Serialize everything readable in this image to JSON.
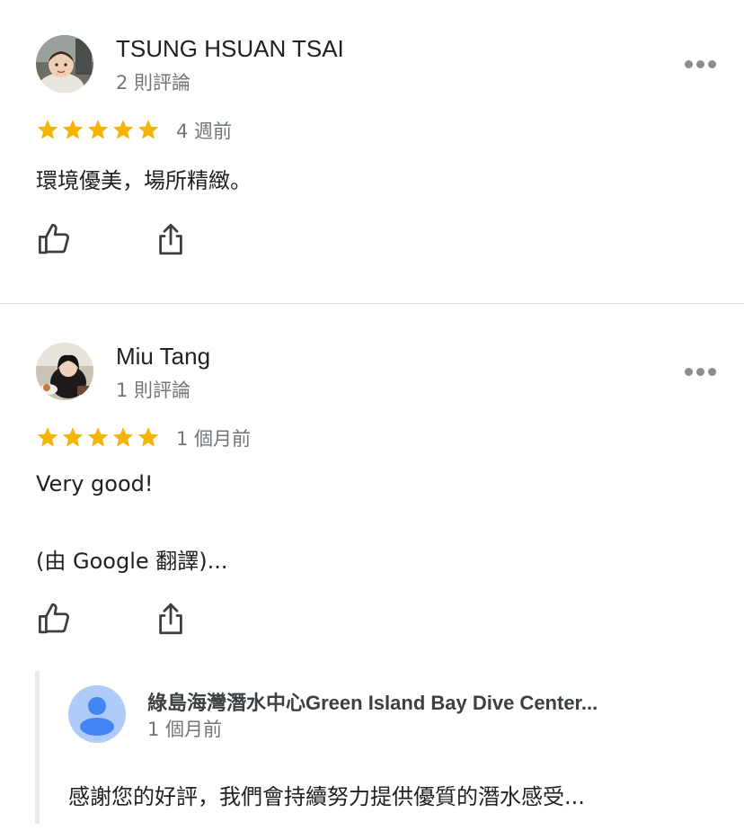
{
  "reviews": [
    {
      "name": "TSUNG HSUAN TSAI",
      "review_count": "2 則評論",
      "rating": 5,
      "time": "4 週前",
      "text": "環境優美，場所精緻。"
    },
    {
      "name": "Miu Tang",
      "review_count": "1 則評論",
      "rating": 5,
      "time": "1 個月前",
      "text": "Very good!",
      "translation_note": "(由 Google 翻譯)..."
    }
  ],
  "owner_reply": {
    "name": "綠島海灣潛水中心Green Island Bay Dive Center...",
    "time": "1 個月前",
    "text": "感謝您的好評，我們會持續努力提供優質的潛水感受..."
  },
  "colors": {
    "star": "#f4b400",
    "secondary_text": "#70757a",
    "icon": "#3c4043",
    "owner_avatar_bg": "#aecbfa",
    "owner_avatar_fg": "#4285f4"
  },
  "icons": {
    "like": "thumbs-up-icon",
    "share": "share-icon",
    "more": "more-options-icon",
    "star": "star-icon"
  }
}
